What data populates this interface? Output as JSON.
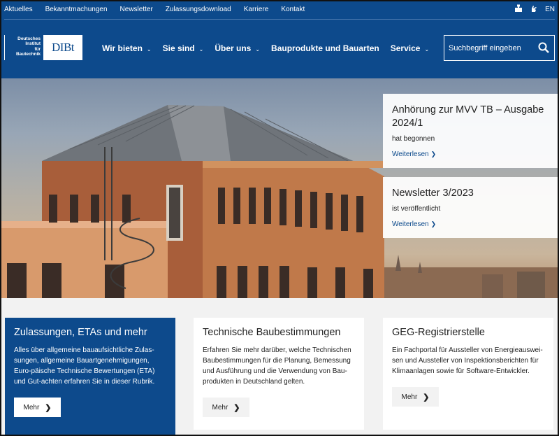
{
  "topbar": {
    "links": [
      "Aktuelles",
      "Bekanntmachungen",
      "Newsletter",
      "Zulassungsdownload",
      "Karriere",
      "Kontakt"
    ],
    "language": "EN"
  },
  "logo": {
    "text_line1": "Deutsches",
    "text_line2": "Institut",
    "text_line3": "für",
    "text_line4": "Bautechnik",
    "mark": "DIBt"
  },
  "nav": {
    "items": [
      "Wir bieten",
      "Sie sind",
      "Über uns",
      "Bauprodukte und Bauarten",
      "Service"
    ]
  },
  "search": {
    "placeholder": "Suchbegriff eingeben"
  },
  "teasers": [
    {
      "title": "Anhörung zur MVV TB – Ausgabe 2024/1",
      "status": "hat begonnen",
      "link": "Weiterlesen"
    },
    {
      "title": "Newsletter 3/2023",
      "status": "ist veröffentlicht",
      "link": "Weiterlesen"
    }
  ],
  "cards": [
    {
      "title": "Zulassungen, ETAs und mehr",
      "text": "Alles über allgemeine bauaufsichtliche Zulas-sungen, allgemeine Bauartgenehmigungen, Euro-päische Technische Bewertungen (ETA) und Gut-achten erfahren Sie in dieser Rubrik.",
      "button": "Mehr"
    },
    {
      "title": "Technische Baubestimmungen",
      "text": "Erfahren Sie mehr darüber, welche Technischen Baubestimmungen für die Planung, Bemessung und Ausführung und die Verwendung von Bau-produkten in Deutschland gelten.",
      "button": "Mehr"
    },
    {
      "title": "GEG-Registrierstelle",
      "text": "Ein Fachportal für Aussteller von Energieauswei-sen und Aussteller von Inspektionsberichten für Klimaanlagen sowie für Software-Entwickler.",
      "button": "Mehr"
    }
  ],
  "colors": {
    "brand": "#0d4a8c",
    "card_bg": "#ffffff",
    "page_bg": "#f2f2f2"
  }
}
